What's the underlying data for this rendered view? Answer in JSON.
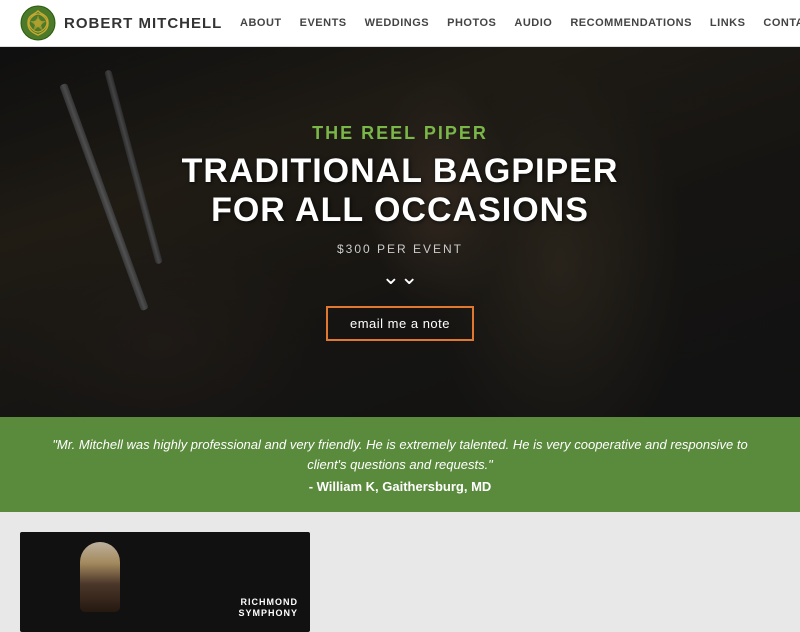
{
  "header": {
    "site_name": "Robert Mitchell",
    "logo_alt": "decorative celtic knot logo"
  },
  "nav": {
    "items": [
      {
        "label": "ABOUT",
        "id": "about"
      },
      {
        "label": "EVENTS",
        "id": "events"
      },
      {
        "label": "WEDDINGS",
        "id": "weddings"
      },
      {
        "label": "PHOTOS",
        "id": "photos"
      },
      {
        "label": "AUDIO",
        "id": "audio"
      },
      {
        "label": "RECOMMENDATIONS",
        "id": "recommendations"
      },
      {
        "label": "LINKS",
        "id": "links"
      },
      {
        "label": "CONTACT",
        "id": "contact"
      }
    ]
  },
  "hero": {
    "subtitle": "THE REEL PIPER",
    "title_line1": "TRADITIONAL BAGPIPER",
    "title_line2": "FOR ALL OCCASIONS",
    "price": "$300 PER EVENT",
    "email_button": "email me a note"
  },
  "testimonial": {
    "quote": "\"Mr. Mitchell was highly professional and very friendly. He is extremely talented. He is very cooperative and responsive to client's questions and requests.\"",
    "author": "- William K, Gaithersburg, MD"
  },
  "lower_card": {
    "text_line1": "RICHMOND",
    "text_line2": "SYMPHONY"
  }
}
